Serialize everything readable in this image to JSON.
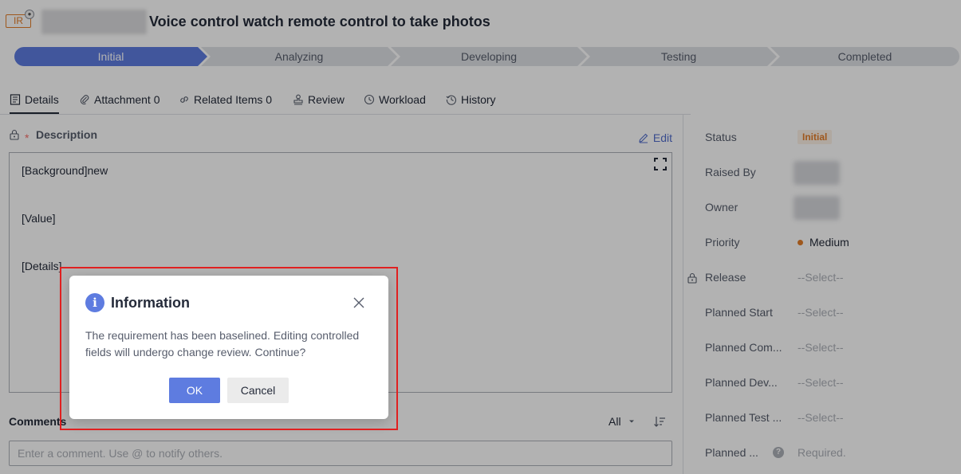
{
  "header": {
    "type_badge": "IR",
    "title": "Voice control watch remote control to take photos"
  },
  "stepper": {
    "steps": [
      {
        "label": "Initial",
        "active": true
      },
      {
        "label": "Analyzing",
        "active": false
      },
      {
        "label": "Developing",
        "active": false
      },
      {
        "label": "Testing",
        "active": false
      },
      {
        "label": "Completed",
        "active": false
      }
    ]
  },
  "tabs": [
    {
      "label": "Details",
      "icon": "document-icon"
    },
    {
      "label": "Attachment 0",
      "icon": "paperclip-icon"
    },
    {
      "label": "Related Items 0",
      "icon": "link-icon"
    },
    {
      "label": "Review",
      "icon": "stamp-icon"
    },
    {
      "label": "Workload",
      "icon": "clock-icon"
    },
    {
      "label": "History",
      "icon": "history-icon"
    }
  ],
  "description": {
    "required_mark": "*",
    "label": "Description",
    "edit_label": "Edit",
    "lines": [
      "[Background]new",
      "[Value]",
      "[Details]"
    ]
  },
  "comments": {
    "label": "Comments",
    "filter_value": "All",
    "input_placeholder": "Enter a comment. Use @ to notify others."
  },
  "fields": {
    "status": {
      "label": "Status",
      "value": "Initial",
      "required": "*"
    },
    "raised_by": {
      "label": "Raised By",
      "required": "*"
    },
    "owner": {
      "label": "Owner",
      "required": "*"
    },
    "priority": {
      "label": "Priority",
      "value": "Medium"
    },
    "release": {
      "label": "Release",
      "value": "--Select--"
    },
    "planned_start": {
      "label": "Planned Start",
      "value": "--Select--"
    },
    "planned_completion": {
      "label": "Planned Com...",
      "value": "--Select--"
    },
    "planned_dev": {
      "label": "Planned Dev...",
      "value": "--Select--"
    },
    "planned_test": {
      "label": "Planned Test ...",
      "value": "--Select--"
    },
    "planned_other": {
      "label": "Planned ...",
      "value": "Required."
    }
  },
  "dialog": {
    "title": "Information",
    "body": "The requirement has been baselined. Editing controlled fields will undergo change review. Continue?",
    "ok_label": "OK",
    "cancel_label": "Cancel"
  },
  "colors": {
    "accent": "#5e7ce0",
    "status_orange": "#e37d29",
    "required_red": "#f66f6a",
    "highlight_red": "#e02020"
  }
}
